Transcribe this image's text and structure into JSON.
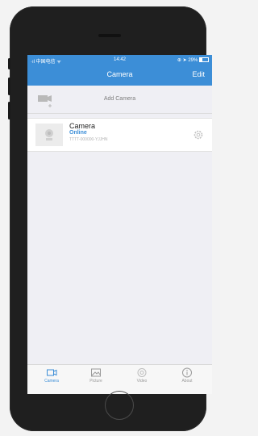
{
  "status_bar": {
    "carrier": "中国电信",
    "time": "14:42",
    "battery": "29%"
  },
  "nav": {
    "title": "Camera",
    "edit_label": "Edit"
  },
  "add_camera": {
    "label": "Add Camera",
    "icon": "camera-plus-icon"
  },
  "camera_list": [
    {
      "name": "Camera",
      "status": "Online",
      "device_id": "TTTT-000000-YJJHN",
      "icon": "settings-gear-icon"
    }
  ],
  "tabs": [
    {
      "label": "Camera",
      "icon": "camera-tab-icon",
      "active": true
    },
    {
      "label": "Picture",
      "icon": "picture-icon",
      "active": false
    },
    {
      "label": "Video",
      "icon": "video-icon",
      "active": false
    },
    {
      "label": "About",
      "icon": "info-icon",
      "active": false
    }
  ],
  "colors": {
    "accent": "#3c8ed7",
    "phone_body": "#1f1f1f",
    "screen_bg": "#efeff4"
  }
}
